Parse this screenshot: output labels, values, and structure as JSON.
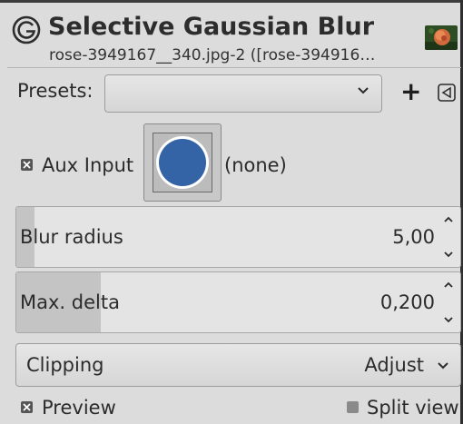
{
  "header": {
    "title": "Selective Gaussian Blur",
    "subtitle": "rose-3949167__340.jpg-2 ([rose-394916…",
    "app_icon": "gimp-icon",
    "thumbnail_icon": "rose-thumbnail"
  },
  "presets": {
    "label": "Presets:",
    "selected": "",
    "add_icon": "plus-icon",
    "menu_icon": "triangle-left-icon",
    "add_label": "+"
  },
  "aux_input": {
    "checked": true,
    "label": "Aux Input",
    "value": "(none)",
    "color": "#3463a6"
  },
  "params": [
    {
      "label": "Blur radius",
      "value": "5,00",
      "fill_fraction": 0.04
    },
    {
      "label": "Max. delta",
      "value": "0,200",
      "fill_fraction": 0.19
    }
  ],
  "clipping": {
    "label": "Clipping",
    "value": "Adjust"
  },
  "preview": {
    "label": "Preview",
    "checked": true
  },
  "split_view": {
    "label": "Split view",
    "checked": false
  },
  "colors": {
    "background": "#dcdcdc",
    "accent_blue": "#3463a6",
    "text": "#2b2b2b"
  }
}
